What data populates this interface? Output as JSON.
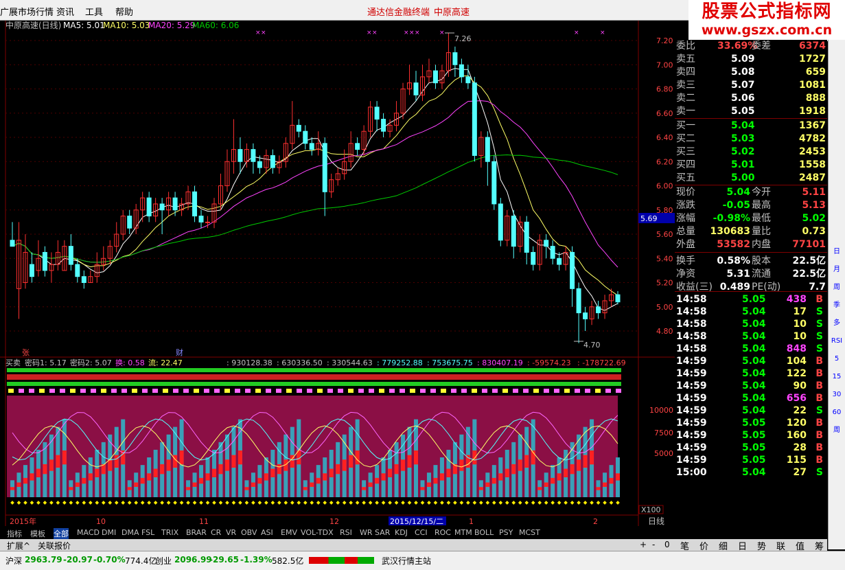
{
  "menu": {
    "item0": "广展市场行情",
    "item1": "资讯",
    "item2": "工具",
    "item3": "帮助",
    "center_left": "通达信金融终端",
    "center_right": "中原高速"
  },
  "watermark": {
    "line1": "股票公式指标网",
    "line2": "www.gszx.com.cn"
  },
  "chart": {
    "title": "中原高速(日线)",
    "ma5": "MA5: 5.01",
    "ma10": "MA10: 5.03",
    "ma20": "MA20: 5.29",
    "ma60": "MA60: 6.06",
    "yaxis": [
      "7.20",
      "7.00",
      "6.80",
      "6.60",
      "6.40",
      "6.20",
      "6.00",
      "5.80",
      "5.60",
      "5.40",
      "5.20",
      "5.00",
      "4.80"
    ],
    "price_marker": "5.69",
    "high_label": "7.26",
    "low_label": "4.70",
    "mark_zhang": "张",
    "mark_cai": "财",
    "xaxis": [
      "2015年",
      "10",
      "11",
      "12",
      "2015/12/15/二",
      "1",
      "2"
    ],
    "sub_yaxis": [
      "10000",
      "7500",
      "5000"
    ],
    "sub_scale": "X100",
    "sub_header": {
      "name": "买卖",
      "m1": "密码1: 5.17",
      "m2": "密码2: 5.07",
      "huan": "换: 0.58",
      "liu": "流: 22.47",
      "v1": ": 930128.38",
      "v2": ": 630336.50",
      "v3": ": 330544.63",
      "v4": ": 779252.88",
      "v5": ": 753675.75",
      "v6": ": 830407.19",
      "v7": ": -59574.23",
      "v8": ": -178722.69"
    },
    "period": "日线",
    "ctrl": [
      "+",
      "-",
      "0"
    ]
  },
  "chart_data": {
    "type": "candlestick",
    "title": "中原高速(日线)",
    "y_range": [
      4.7,
      7.26
    ],
    "ma_legend": {
      "MA5": 5.01,
      "MA10": 5.03,
      "MA20": 5.29,
      "MA60": 6.06
    },
    "ma_colors": {
      "MA5": "#ffffff",
      "MA10": "#ffff66",
      "MA20": "#ff44ff",
      "MA60": "#00cc00"
    },
    "up_color": "#ff3030",
    "down_color": "#54ffff",
    "candles": [
      [
        5.55,
        5.5,
        5.7,
        5.5
      ],
      [
        5.15,
        5.55,
        5.7,
        4.9
      ],
      [
        5.2,
        5.45,
        5.6,
        5.15
      ],
      [
        5.35,
        5.25,
        5.45,
        5.2
      ],
      [
        5.3,
        5.4,
        5.55,
        5.25
      ],
      [
        5.45,
        5.3,
        5.5,
        5.25
      ],
      [
        5.3,
        5.35,
        5.45,
        5.2
      ],
      [
        5.35,
        5.45,
        5.55,
        5.3
      ],
      [
        5.3,
        5.5,
        5.55,
        5.3
      ],
      [
        5.5,
        5.35,
        5.6,
        5.3
      ],
      [
        5.35,
        5.25,
        5.4,
        5.2
      ],
      [
        5.25,
        5.2,
        5.3,
        5.15
      ],
      [
        5.2,
        5.25,
        5.3,
        5.2
      ],
      [
        5.25,
        5.35,
        5.45,
        5.2
      ],
      [
        5.35,
        5.4,
        5.5,
        5.3
      ],
      [
        5.4,
        5.5,
        5.55,
        5.35
      ],
      [
        5.5,
        5.6,
        5.7,
        5.45
      ],
      [
        5.6,
        5.75,
        5.8,
        5.55
      ],
      [
        5.75,
        5.65,
        5.8,
        5.6
      ],
      [
        5.65,
        5.8,
        5.85,
        5.6
      ],
      [
        5.8,
        5.9,
        5.95,
        5.7
      ],
      [
        5.9,
        5.75,
        5.95,
        5.7
      ],
      [
        5.75,
        5.85,
        5.9,
        5.7
      ],
      [
        5.85,
        5.8,
        5.9,
        5.6
      ],
      [
        5.8,
        5.9,
        5.95,
        5.75
      ],
      [
        5.9,
        5.8,
        5.95,
        5.75
      ],
      [
        5.8,
        5.85,
        5.9,
        5.75
      ],
      [
        5.85,
        5.95,
        6.0,
        5.8
      ],
      [
        5.95,
        5.75,
        6.0,
        5.7
      ],
      [
        5.75,
        5.7,
        5.8,
        5.65
      ],
      [
        5.7,
        5.7,
        5.75,
        5.65
      ],
      [
        5.7,
        5.85,
        5.9,
        5.65
      ],
      [
        5.85,
        6.0,
        6.1,
        5.8
      ],
      [
        6.0,
        6.2,
        6.3,
        5.95
      ],
      [
        6.2,
        6.3,
        6.55,
        6.1
      ],
      [
        6.3,
        6.2,
        6.4,
        6.1
      ],
      [
        6.2,
        6.3,
        6.35,
        6.15
      ],
      [
        6.3,
        6.2,
        6.35,
        6.1
      ],
      [
        6.2,
        6.15,
        6.25,
        6.1
      ],
      [
        6.15,
        6.25,
        6.3,
        6.1
      ],
      [
        6.25,
        6.15,
        6.3,
        6.1
      ],
      [
        6.15,
        6.2,
        6.25,
        6.1
      ],
      [
        6.2,
        6.35,
        6.4,
        6.15
      ],
      [
        6.35,
        6.5,
        6.7,
        6.3
      ],
      [
        6.5,
        6.45,
        6.55,
        6.4
      ],
      [
        6.45,
        6.35,
        6.5,
        6.3
      ],
      [
        6.35,
        6.3,
        6.4,
        6.25
      ],
      [
        6.3,
        6.35,
        6.45,
        6.25
      ],
      [
        6.35,
        5.95,
        6.4,
        5.75
      ],
      [
        5.95,
        6.05,
        6.1,
        5.9
      ],
      [
        6.05,
        6.1,
        6.15,
        6.0
      ],
      [
        6.1,
        6.2,
        6.3,
        6.05
      ],
      [
        6.2,
        6.35,
        6.45,
        6.15
      ],
      [
        6.35,
        6.3,
        6.4,
        6.25
      ],
      [
        6.3,
        6.45,
        6.5,
        6.25
      ],
      [
        6.45,
        6.65,
        6.7,
        6.4
      ],
      [
        6.65,
        6.55,
        6.7,
        6.45
      ],
      [
        6.55,
        6.45,
        6.6,
        6.4
      ],
      [
        6.45,
        6.5,
        6.55,
        6.4
      ],
      [
        6.5,
        6.6,
        6.7,
        6.45
      ],
      [
        6.6,
        6.8,
        6.85,
        6.55
      ],
      [
        6.8,
        6.85,
        7.0,
        6.75
      ],
      [
        6.85,
        6.75,
        6.95,
        6.7
      ],
      [
        6.75,
        6.9,
        7.0,
        6.7
      ],
      [
        6.9,
        6.95,
        7.05,
        6.85
      ],
      [
        6.95,
        6.85,
        7.0,
        6.8
      ],
      [
        6.85,
        6.95,
        7.0,
        6.8
      ],
      [
        6.95,
        7.1,
        7.26,
        6.9
      ],
      [
        7.1,
        7.0,
        7.15,
        6.9
      ],
      [
        7.0,
        6.9,
        7.05,
        6.85
      ],
      [
        6.9,
        6.85,
        7.0,
        6.8
      ],
      [
        6.85,
        6.25,
        6.9,
        6.2
      ],
      [
        6.25,
        6.4,
        6.45,
        6.15
      ],
      [
        6.4,
        6.2,
        6.45,
        6.0
      ],
      [
        6.2,
        5.85,
        6.25,
        5.8
      ],
      [
        5.85,
        5.55,
        5.9,
        5.5
      ],
      [
        5.55,
        5.75,
        5.8,
        5.5
      ],
      [
        5.75,
        5.5,
        5.8,
        5.4
      ],
      [
        5.5,
        5.7,
        5.75,
        5.45
      ],
      [
        5.7,
        5.45,
        5.75,
        5.35
      ],
      [
        5.45,
        5.35,
        5.5,
        5.3
      ],
      [
        5.35,
        5.55,
        5.6,
        5.3
      ],
      [
        5.55,
        5.5,
        5.6,
        5.4
      ],
      [
        5.5,
        5.4,
        5.55,
        5.35
      ],
      [
        5.4,
        5.35,
        5.45,
        5.3
      ],
      [
        5.35,
        5.45,
        5.5,
        5.3
      ],
      [
        5.45,
        5.15,
        5.5,
        5.0
      ],
      [
        5.15,
        4.95,
        5.2,
        4.7
      ],
      [
        4.95,
        4.9,
        5.0,
        4.8
      ],
      [
        4.9,
        5.0,
        5.05,
        4.85
      ],
      [
        5.0,
        4.95,
        5.05,
        4.9
      ],
      [
        4.95,
        5.05,
        5.1,
        4.9
      ],
      [
        5.05,
        5.1,
        5.15,
        5.0
      ],
      [
        5.1,
        5.04,
        5.13,
        5.02
      ]
    ],
    "sub_series": {
      "name": "买卖",
      "密码1": 5.17,
      "密码2": 5.07,
      "换": 0.58,
      "流": 22.47
    },
    "sub_y_labels": [
      10000,
      7500,
      5000
    ]
  },
  "quote": {
    "webi_label": "委比",
    "webi_val": "33.69%",
    "wecha_label": "委差",
    "wecha_val": "6374",
    "asks": [
      {
        "l": "卖五",
        "p": "5.09",
        "v": "1727"
      },
      {
        "l": "卖四",
        "p": "5.08",
        "v": "659"
      },
      {
        "l": "卖三",
        "p": "5.07",
        "v": "1081"
      },
      {
        "l": "卖二",
        "p": "5.06",
        "v": "888"
      },
      {
        "l": "卖一",
        "p": "5.05",
        "v": "1918"
      }
    ],
    "bids": [
      {
        "l": "买一",
        "p": "5.04",
        "v": "1367"
      },
      {
        "l": "买二",
        "p": "5.03",
        "v": "4782"
      },
      {
        "l": "买三",
        "p": "5.02",
        "v": "2453"
      },
      {
        "l": "买四",
        "p": "5.01",
        "v": "1558"
      },
      {
        "l": "买五",
        "p": "5.00",
        "v": "2487"
      }
    ],
    "stats": [
      {
        "l1": "现价",
        "v1": "5.04",
        "l2": "今开",
        "v2": "5.11"
      },
      {
        "l1": "涨跌",
        "v1": "-0.05",
        "l2": "最高",
        "v2": "5.13"
      },
      {
        "l1": "涨幅",
        "v1": "-0.98%",
        "l2": "最低",
        "v2": "5.02"
      },
      {
        "l1": "总量",
        "v1": "130683",
        "l2": "量比",
        "v2": "0.73"
      },
      {
        "l1": "外盘",
        "v1": "53582",
        "l2": "内盘",
        "v2": "77101"
      },
      {
        "l1": "换手",
        "v1": "0.58%",
        "l2": "股本",
        "v2": "22.5亿"
      },
      {
        "l1": "净资",
        "v1": "5.31",
        "l2": "流通",
        "v2": "22.5亿"
      },
      {
        "l1": "收益(三)",
        "v1": "0.489",
        "l2": "PE(动)",
        "v2": "7.7"
      }
    ],
    "ticks": [
      {
        "t": "14:58",
        "p": "5.05",
        "v": "438",
        "d": "B"
      },
      {
        "t": "14:58",
        "p": "5.04",
        "v": "17",
        "d": "S"
      },
      {
        "t": "14:58",
        "p": "5.04",
        "v": "10",
        "d": "S"
      },
      {
        "t": "14:58",
        "p": "5.04",
        "v": "10",
        "d": "S"
      },
      {
        "t": "14:58",
        "p": "5.04",
        "v": "848",
        "d": "S"
      },
      {
        "t": "14:59",
        "p": "5.04",
        "v": "104",
        "d": "B"
      },
      {
        "t": "14:59",
        "p": "5.04",
        "v": "122",
        "d": "B"
      },
      {
        "t": "14:59",
        "p": "5.04",
        "v": "90",
        "d": "B"
      },
      {
        "t": "14:59",
        "p": "5.04",
        "v": "656",
        "d": "B"
      },
      {
        "t": "14:59",
        "p": "5.04",
        "v": "22",
        "d": "S"
      },
      {
        "t": "14:59",
        "p": "5.05",
        "v": "120",
        "d": "B"
      },
      {
        "t": "14:59",
        "p": "5.05",
        "v": "160",
        "d": "B"
      },
      {
        "t": "14:59",
        "p": "5.05",
        "v": "28",
        "d": "B"
      },
      {
        "t": "14:59",
        "p": "5.05",
        "v": "115",
        "d": "B"
      },
      {
        "t": "15:00",
        "p": "5.04",
        "v": "27",
        "d": "S"
      }
    ]
  },
  "indicator_tabs": [
    "指标",
    "模板",
    "全部",
    "MACD",
    "DMI",
    "DMA",
    "FSL",
    "TRIX",
    "BRAR",
    "CR",
    "VR",
    "OBV",
    "ASI",
    "EMV",
    "VOL-TDX",
    "RSI",
    "WR",
    "SAR",
    "KDJ",
    "CCI",
    "ROC",
    "MTM",
    "BOLL",
    "PSY",
    "MCST"
  ],
  "sub_tabs": [
    "扩展^",
    "关联报价"
  ],
  "right_tabs": [
    "笔",
    "价",
    "细",
    "日",
    "势",
    "联",
    "值",
    "筹"
  ],
  "side_icons": [
    "日",
    "月",
    "周",
    "季",
    "多",
    "RSI",
    "5",
    "15",
    "30",
    "60",
    "周"
  ],
  "status": {
    "sh_label": "沪深",
    "sh": "2963.79",
    "sh_chg": "-20.97",
    "sh_pct": "-0.70%",
    "sh_amt": "774.4亿",
    "cy_label": "创业",
    "cy": "2096.99",
    "cy_chg": "-29.65",
    "cy_pct": "-1.39%",
    "cy_amt": "582.5亿",
    "site": "武汉行情主站"
  }
}
